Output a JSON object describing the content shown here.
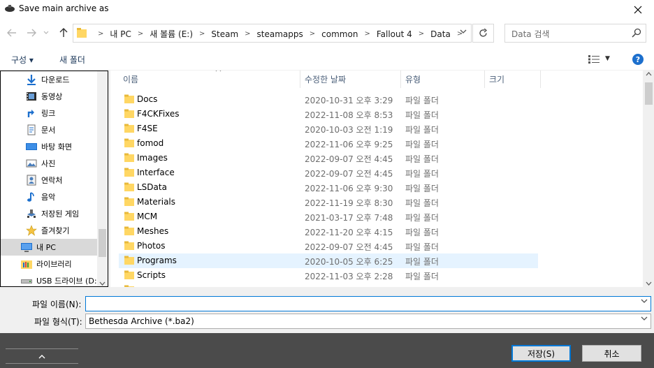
{
  "window": {
    "title": "Save main archive as"
  },
  "address": {
    "crumbs": [
      "내 PC",
      "새 볼륨 (E:)",
      "Steam",
      "steamapps",
      "common",
      "Fallout 4",
      "Data"
    ]
  },
  "search": {
    "placeholder": "Data 검색"
  },
  "toolbar": {
    "organize": "구성 ▾",
    "new_folder": "새 폴더"
  },
  "nav_pane": {
    "items": [
      {
        "label": "다운로드",
        "icon": "download-icon"
      },
      {
        "label": "동영상",
        "icon": "video-icon"
      },
      {
        "label": "링크",
        "icon": "link-icon"
      },
      {
        "label": "문서",
        "icon": "document-icon"
      },
      {
        "label": "바탕 화면",
        "icon": "desktop-icon"
      },
      {
        "label": "사진",
        "icon": "picture-icon"
      },
      {
        "label": "연락처",
        "icon": "contacts-icon"
      },
      {
        "label": "음악",
        "icon": "music-icon"
      },
      {
        "label": "저장된 게임",
        "icon": "saved-games-icon"
      },
      {
        "label": "즐겨찾기",
        "icon": "favorites-icon"
      },
      {
        "label": "내 PC",
        "icon": "pc-icon"
      },
      {
        "label": "라이브러리",
        "icon": "library-icon"
      },
      {
        "label": "USB 드라이브 (D:",
        "icon": "usb-drive-icon"
      }
    ],
    "selected": "내 PC"
  },
  "columns": {
    "name": "이름",
    "date": "수정한 날짜",
    "type": "유형",
    "size": "크기"
  },
  "files": [
    {
      "name": "Docs",
      "date": "2020-10-31 오후 3:29",
      "type": "파일 폴더"
    },
    {
      "name": "F4CKFixes",
      "date": "2022-11-08 오후 8:53",
      "type": "파일 폴더"
    },
    {
      "name": "F4SE",
      "date": "2020-10-03 오전 1:19",
      "type": "파일 폴더"
    },
    {
      "name": "fomod",
      "date": "2022-11-06 오후 9:25",
      "type": "파일 폴더"
    },
    {
      "name": "Images",
      "date": "2022-09-07 오전 4:45",
      "type": "파일 폴더"
    },
    {
      "name": "Interface",
      "date": "2022-09-07 오전 4:45",
      "type": "파일 폴더"
    },
    {
      "name": "LSData",
      "date": "2022-11-06 오후 9:30",
      "type": "파일 폴더"
    },
    {
      "name": "Materials",
      "date": "2022-11-19 오후 8:30",
      "type": "파일 폴더"
    },
    {
      "name": "MCM",
      "date": "2021-03-17 오후 7:48",
      "type": "파일 폴더"
    },
    {
      "name": "Meshes",
      "date": "2022-11-20 오후 4:15",
      "type": "파일 폴더"
    },
    {
      "name": "Photos",
      "date": "2022-09-07 오전 4:45",
      "type": "파일 폴더"
    },
    {
      "name": "Programs",
      "date": "2020-10-05 오후 6:25",
      "type": "파일 폴더"
    },
    {
      "name": "Scripts",
      "date": "2022-11-03 오후 2:28",
      "type": "파일 폴더"
    }
  ],
  "highlighted_file": "Programs",
  "form": {
    "filename_label": "파일 이름(N):",
    "filename_value": "",
    "filetype_label": "파일 형식(T):",
    "filetype_value": "Bethesda Archive (*.ba2)"
  },
  "buttons": {
    "save": "저장(S)",
    "cancel": "취소"
  },
  "colors": {
    "accent": "#0078d7",
    "selection": "#e5f3ff",
    "folder": "#ffd764",
    "bottom_bar": "#4b4b4b"
  }
}
